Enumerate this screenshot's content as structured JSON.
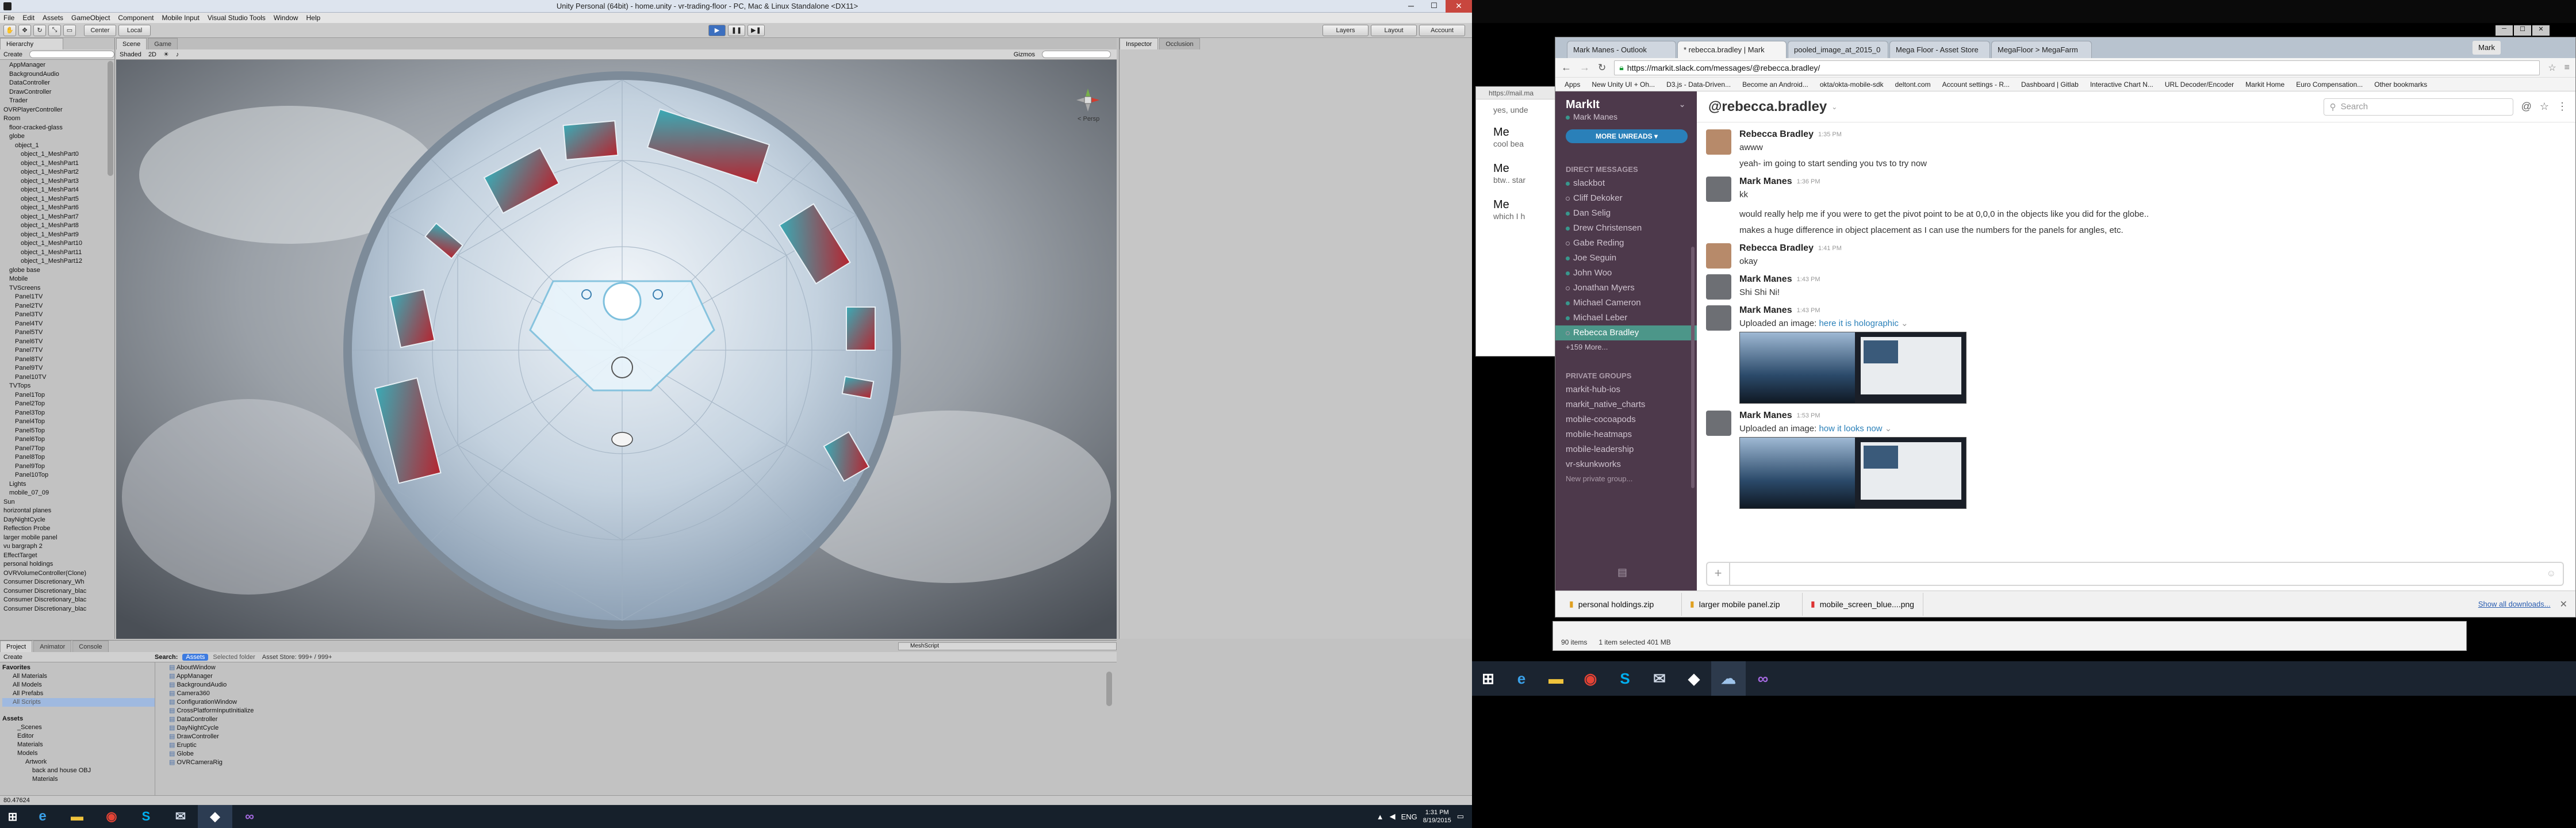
{
  "unity": {
    "title": "Unity Personal (64bit) - home.unity - vr-trading-floor - PC, Mac & Linux Standalone <DX11>",
    "menu": [
      "File",
      "Edit",
      "Assets",
      "GameObject",
      "Component",
      "Mobile Input",
      "Visual Studio Tools",
      "Window",
      "Help"
    ],
    "toolbar": {
      "center": "Center",
      "local": "Local",
      "layers": "Layers",
      "layout": "Layout",
      "account": "Account"
    },
    "hierarchy": {
      "tab": "Hierarchy",
      "create": "Create",
      "items": [
        {
          "label": "AppManager",
          "indent": 1
        },
        {
          "label": "BackgroundAudio",
          "indent": 1
        },
        {
          "label": "DataController",
          "indent": 1
        },
        {
          "label": "DrawController",
          "indent": 1
        },
        {
          "label": "Trader",
          "indent": 1
        },
        {
          "label": "OVRPlayerController",
          "indent": 0
        },
        {
          "label": "Room",
          "indent": 0
        },
        {
          "label": "floor-cracked-glass",
          "indent": 1
        },
        {
          "label": "globe",
          "indent": 1
        },
        {
          "label": "object_1",
          "indent": 2
        },
        {
          "label": "object_1_MeshPart0",
          "indent": 3
        },
        {
          "label": "object_1_MeshPart1",
          "indent": 3
        },
        {
          "label": "object_1_MeshPart2",
          "indent": 3
        },
        {
          "label": "object_1_MeshPart3",
          "indent": 3
        },
        {
          "label": "object_1_MeshPart4",
          "indent": 3
        },
        {
          "label": "object_1_MeshPart5",
          "indent": 3
        },
        {
          "label": "object_1_MeshPart6",
          "indent": 3
        },
        {
          "label": "object_1_MeshPart7",
          "indent": 3
        },
        {
          "label": "object_1_MeshPart8",
          "indent": 3
        },
        {
          "label": "object_1_MeshPart9",
          "indent": 3
        },
        {
          "label": "object_1_MeshPart10",
          "indent": 3
        },
        {
          "label": "object_1_MeshPart11",
          "indent": 3
        },
        {
          "label": "object_1_MeshPart12",
          "indent": 3
        },
        {
          "label": "globe base",
          "indent": 1
        },
        {
          "label": "Mobile",
          "indent": 1
        },
        {
          "label": "TVScreens",
          "indent": 1
        },
        {
          "label": "Panel1TV",
          "indent": 2
        },
        {
          "label": "Panel2TV",
          "indent": 2
        },
        {
          "label": "Panel3TV",
          "indent": 2
        },
        {
          "label": "Panel4TV",
          "indent": 2
        },
        {
          "label": "Panel5TV",
          "indent": 2
        },
        {
          "label": "Panel6TV",
          "indent": 2
        },
        {
          "label": "Panel7TV",
          "indent": 2
        },
        {
          "label": "Panel8TV",
          "indent": 2
        },
        {
          "label": "Panel9TV",
          "indent": 2
        },
        {
          "label": "Panel10TV",
          "indent": 2
        },
        {
          "label": "TVTops",
          "indent": 1
        },
        {
          "label": "Panel1Top",
          "indent": 2
        },
        {
          "label": "Panel2Top",
          "indent": 2
        },
        {
          "label": "Panel3Top",
          "indent": 2
        },
        {
          "label": "Panel4Top",
          "indent": 2
        },
        {
          "label": "Panel5Top",
          "indent": 2
        },
        {
          "label": "Panel6Top",
          "indent": 2
        },
        {
          "label": "Panel7Top",
          "indent": 2
        },
        {
          "label": "Panel8Top",
          "indent": 2
        },
        {
          "label": "Panel9Top",
          "indent": 2
        },
        {
          "label": "Panel10Top",
          "indent": 2
        },
        {
          "label": "Lights",
          "indent": 1
        },
        {
          "label": "mobile_07_09",
          "indent": 1
        },
        {
          "label": "Sun",
          "indent": 0
        },
        {
          "label": "horizontal planes",
          "indent": 0
        },
        {
          "label": "DayNightCycle",
          "indent": 0
        },
        {
          "label": "Reflection Probe",
          "indent": 0
        },
        {
          "label": "larger mobile panel",
          "indent": 0
        },
        {
          "label": "vu bargraph 2",
          "indent": 0
        },
        {
          "label": "EffectTarget",
          "indent": 0
        },
        {
          "label": "personal holdings",
          "indent": 0
        },
        {
          "label": "OVRVolumeController(Clone)",
          "indent": 0
        },
        {
          "label": "Consumer Discretionary_Wh",
          "indent": 0
        },
        {
          "label": "Consumer Discretionary_blac",
          "indent": 0
        },
        {
          "label": "Consumer Discretionary_blac",
          "indent": 0
        },
        {
          "label": "Consumer Discretionary_blac",
          "indent": 0
        }
      ]
    },
    "scene": {
      "tabs": [
        "Scene",
        "Game"
      ],
      "shaded": "Shaded",
      "mode": "2D",
      "gizmos": "Gizmos",
      "persp": "< Persp"
    },
    "inspector": {
      "tabs": [
        "Inspector",
        "Occlusion"
      ]
    },
    "bottom": {
      "tabs": [
        "Project",
        "Animator",
        "Console"
      ],
      "create": "Create",
      "search_label": "Search:",
      "search_scopes": [
        "Assets",
        "Selected folder",
        "Asset Store: 999+ / 999+"
      ],
      "mesh_script": "MeshScript",
      "favorites": [
        "Favorites",
        "All Materials",
        "All Models",
        "All Prefabs",
        "All Scripts"
      ],
      "assets_tree": [
        "Assets",
        "_Scenes",
        "Editor",
        "Materials",
        "Models",
        "Artwork",
        "back and house OBJ",
        "Materials"
      ],
      "files": [
        "AboutWindow",
        "AppManager",
        "BackgroundAudio",
        "Camera360",
        "ConfigurationWindow",
        "CrossPlatformInputInitialize",
        "DataController",
        "DayNightCycle",
        "DrawController",
        "Eruptic",
        "Globe",
        "OVRCameraRig"
      ],
      "status": "80.47624"
    }
  },
  "taskbar_left": {
    "icons": [
      "windows-start-icon",
      "edge-icon",
      "explorer-icon",
      "chrome-icon",
      "skype-icon",
      "outlook-icon",
      "unity-icon",
      "visual-studio-icon"
    ],
    "tray": {
      "lang": "ENG",
      "time": "1:31 PM",
      "date": "8/19/2015"
    }
  },
  "taskbar_right": {
    "icons": [
      "windows-start-icon",
      "edge-icon",
      "explorer-icon",
      "chrome-icon",
      "skype-icon",
      "outlook-icon",
      "unity-icon",
      "cloud-icon",
      "visual-studio-icon"
    ]
  },
  "behind_window": {
    "url": "https://mail.ma",
    "chat": [
      {
        "line": "yes, unde"
      },
      {
        "name": "Me",
        "line": "cool bea"
      },
      {
        "name": "Me",
        "line": "btw.. star"
      },
      {
        "name": "Me",
        "line": "which I h"
      }
    ]
  },
  "explorer_status": {
    "items": "90 items",
    "selected": "1 item selected  401 MB"
  },
  "chrome": {
    "tabs": [
      "Mark Manes - Outlook",
      "* rebecca.bradley | Mark",
      "pooled_image_at_2015_0",
      "Mega Floor - Asset Store",
      "MegaFloor > MegaFarm"
    ],
    "user": "Mark",
    "url": "https://markit.slack.com/messages/@rebecca.bradley/",
    "bookmarks": [
      "Apps",
      "New Unity UI + Oh...",
      "D3.js - Data-Driven...",
      "Become an Android...",
      "okta/okta-mobile-sdk",
      "deltont.com",
      "Account settings - R...",
      "Dashboard | Gitlab",
      "Interactive Chart N...",
      "URL Decoder/Encoder",
      "Markit Home",
      "Euro Compensation...",
      "Other bookmarks"
    ],
    "downloads": [
      "personal holdings.zip",
      "larger mobile panel.zip",
      "mobile_screen_blue....png"
    ],
    "show_all": "Show all downloads..."
  },
  "slack": {
    "team": "MarkIt",
    "user": "Mark Manes",
    "more_unreads": "MORE UNREADS",
    "dm_header": "DIRECT MESSAGES",
    "dms": [
      "slackbot",
      "Cliff Dekoker",
      "Dan Selig",
      "Drew Christensen",
      "Gabe Reding",
      "Joe Seguin",
      "John Woo",
      "Jonathan Myers",
      "Michael Cameron",
      "Michael Leber",
      "Rebecca Bradley"
    ],
    "more_dms": "+159 More...",
    "groups_header": "PRIVATE GROUPS",
    "groups": [
      "markit-hub-ios",
      "markit_native_charts",
      "mobile-cocoapods",
      "mobile-heatmaps",
      "mobile-leadership",
      "vr-skunkworks"
    ],
    "new_group": "New private group...",
    "channel_title": "@rebecca.bradley",
    "search_placeholder": "Search",
    "messages": [
      {
        "name": "Rebecca Bradley",
        "time": "1:35 PM",
        "lines": [
          "awww",
          "yeah- im going to start sending you tvs to try now"
        ]
      },
      {
        "name": "Mark Manes",
        "time": "1:36 PM",
        "lines": [
          "kk",
          "would really help me if you were to get the pivot point to be at 0,0,0 in the objects like you did for the globe..",
          "makes a huge difference in object placement as I can use the numbers for the panels for angles, etc."
        ]
      },
      {
        "name": "Rebecca Bradley",
        "time": "1:41 PM",
        "lines": [
          "okay"
        ]
      },
      {
        "name": "Mark Manes",
        "time": "1:43 PM",
        "lines": [
          "Shi Shi Ni!"
        ]
      },
      {
        "name": "Mark Manes",
        "time": "1:43 PM",
        "upload_prefix": "Uploaded an image: ",
        "upload_link": "here it is holographic"
      },
      {
        "name": "Mark Manes",
        "time": "1:53 PM",
        "upload_prefix": "Uploaded an image: ",
        "upload_link": "how it looks now"
      }
    ],
    "composer_plus": "+"
  }
}
